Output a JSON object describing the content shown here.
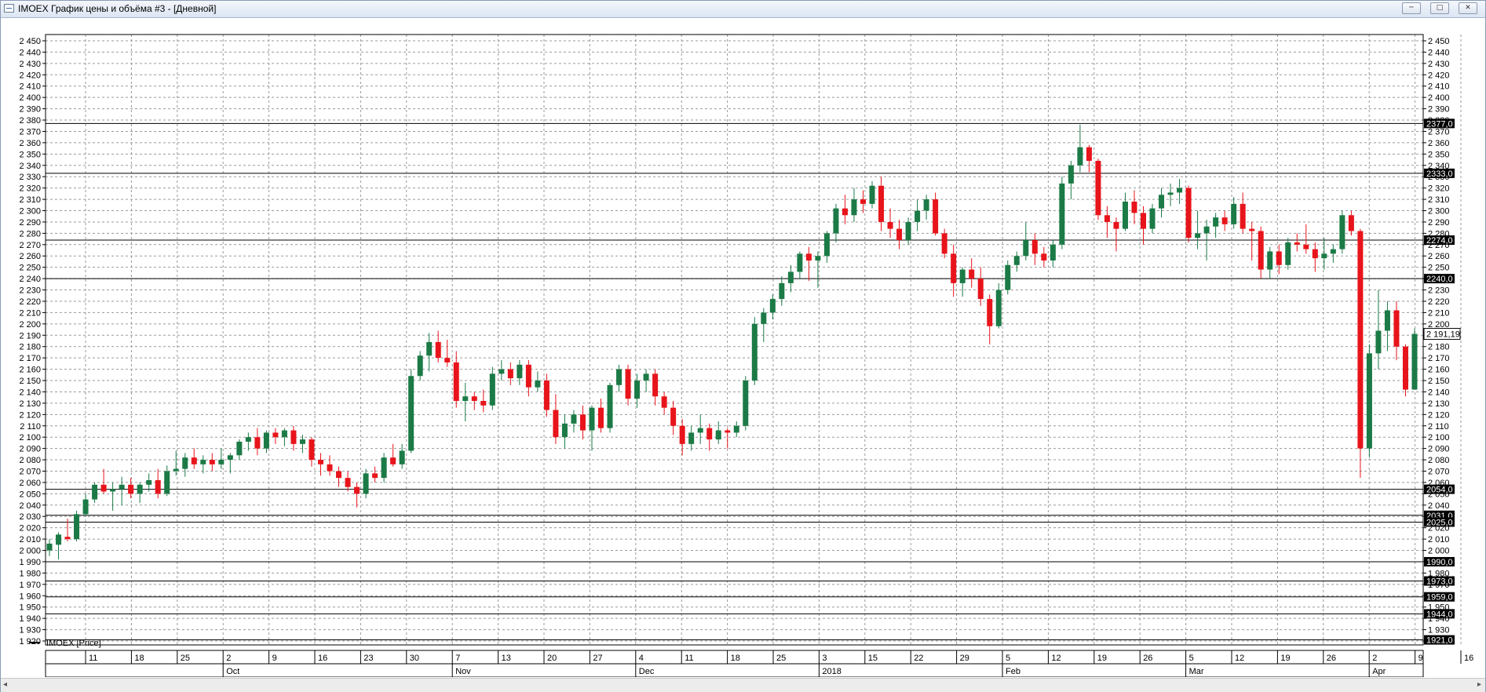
{
  "window": {
    "title": "IMOEX График цены и объёма #3 - [Дневной]",
    "buttons": [
      {
        "name": "minimize-button",
        "glyph": "─"
      },
      {
        "name": "maximize-button",
        "glyph": "□"
      },
      {
        "name": "close-button",
        "glyph": "✕"
      }
    ]
  },
  "legend": {
    "label": "IMOEX [Price]"
  },
  "scrollbar": {
    "left_arrow": "◂",
    "right_arrow": "▸"
  },
  "colors": {
    "up": "#1b7a46",
    "down": "#e8141b",
    "grid": "#9a9a9a",
    "axis": "#000000"
  },
  "chart_data": {
    "type": "candlestick",
    "title": "",
    "ylim": [
      1915,
      2455
    ],
    "y_ticks": [
      1920,
      1930,
      1940,
      1950,
      1960,
      1970,
      1980,
      1990,
      2000,
      2010,
      2020,
      2030,
      2040,
      2050,
      2060,
      2070,
      2080,
      2090,
      2100,
      2110,
      2120,
      2130,
      2140,
      2150,
      2160,
      2170,
      2180,
      2190,
      2200,
      2210,
      2220,
      2230,
      2240,
      2250,
      2260,
      2270,
      2280,
      2290,
      2300,
      2310,
      2320,
      2330,
      2340,
      2350,
      2360,
      2370,
      2380,
      2390,
      2400,
      2410,
      2420,
      2430,
      2440,
      2450
    ],
    "last_price": "2 191,19",
    "levels": [
      {
        "value": 2377,
        "label": "2377,0"
      },
      {
        "value": 2333,
        "label": "2333,0"
      },
      {
        "value": 2274,
        "label": "2274,0"
      },
      {
        "value": 2240,
        "label": "2240,0"
      },
      {
        "value": 2054,
        "label": "2054,0"
      },
      {
        "value": 2031,
        "label": "2031,0"
      },
      {
        "value": 2025,
        "label": "2025,0"
      },
      {
        "value": 1990,
        "label": "1990,0"
      },
      {
        "value": 1973,
        "label": "1973,0"
      },
      {
        "value": 1959,
        "label": "1959,0"
      },
      {
        "value": 1944,
        "label": "1944,0"
      },
      {
        "value": 1921,
        "label": "1921,0"
      }
    ],
    "x_day_labels": [
      "11",
      "18",
      "25",
      "2",
      "9",
      "16",
      "23",
      "30",
      "7",
      "13",
      "20",
      "27",
      "4",
      "11",
      "18",
      "25",
      "3",
      "15",
      "22",
      "29",
      "5",
      "12",
      "19",
      "26",
      "5",
      "12",
      "19",
      "26",
      "2",
      "9",
      "16"
    ],
    "x_month_labels": [
      "Oct",
      "Nov",
      "Dec",
      "2018",
      "Feb",
      "Mar",
      "Apr"
    ],
    "candles": [
      [
        2000,
        2010,
        1995,
        2006
      ],
      [
        2005,
        2016,
        1992,
        2014
      ],
      [
        2012,
        2028,
        2008,
        2010
      ],
      [
        2010,
        2035,
        2008,
        2032
      ],
      [
        2032,
        2050,
        2030,
        2045
      ],
      [
        2045,
        2060,
        2042,
        2058
      ],
      [
        2058,
        2072,
        2050,
        2052
      ],
      [
        2052,
        2060,
        2035,
        2054
      ],
      [
        2054,
        2065,
        2040,
        2058
      ],
      [
        2058,
        2064,
        2046,
        2050
      ],
      [
        2050,
        2060,
        2042,
        2058
      ],
      [
        2058,
        2068,
        2052,
        2062
      ],
      [
        2062,
        2072,
        2046,
        2050
      ],
      [
        2050,
        2075,
        2048,
        2070
      ],
      [
        2070,
        2088,
        2066,
        2072
      ],
      [
        2072,
        2086,
        2065,
        2082
      ],
      [
        2082,
        2090,
        2072,
        2076
      ],
      [
        2076,
        2084,
        2068,
        2080
      ],
      [
        2080,
        2086,
        2070,
        2076
      ],
      [
        2076,
        2090,
        2072,
        2080
      ],
      [
        2080,
        2086,
        2068,
        2084
      ],
      [
        2084,
        2098,
        2080,
        2096
      ],
      [
        2096,
        2104,
        2088,
        2100
      ],
      [
        2100,
        2108,
        2084,
        2090
      ],
      [
        2090,
        2106,
        2086,
        2104
      ],
      [
        2104,
        2108,
        2094,
        2100
      ],
      [
        2100,
        2108,
        2092,
        2106
      ],
      [
        2106,
        2110,
        2088,
        2094
      ],
      [
        2094,
        2102,
        2086,
        2098
      ],
      [
        2098,
        2100,
        2074,
        2080
      ],
      [
        2080,
        2086,
        2066,
        2076
      ],
      [
        2076,
        2084,
        2066,
        2070
      ],
      [
        2070,
        2074,
        2056,
        2064
      ],
      [
        2064,
        2070,
        2052,
        2056
      ],
      [
        2056,
        2060,
        2038,
        2050
      ],
      [
        2050,
        2072,
        2046,
        2068
      ],
      [
        2068,
        2074,
        2060,
        2064
      ],
      [
        2064,
        2086,
        2060,
        2082
      ],
      [
        2082,
        2094,
        2074,
        2076
      ],
      [
        2076,
        2094,
        2072,
        2088
      ],
      [
        2088,
        2160,
        2086,
        2154
      ],
      [
        2154,
        2176,
        2150,
        2172
      ],
      [
        2172,
        2192,
        2158,
        2184
      ],
      [
        2184,
        2194,
        2166,
        2170
      ],
      [
        2170,
        2186,
        2162,
        2166
      ],
      [
        2166,
        2176,
        2126,
        2132
      ],
      [
        2132,
        2148,
        2114,
        2136
      ],
      [
        2136,
        2140,
        2124,
        2132
      ],
      [
        2132,
        2142,
        2122,
        2128
      ],
      [
        2128,
        2162,
        2124,
        2156
      ],
      [
        2156,
        2168,
        2150,
        2160
      ],
      [
        2160,
        2166,
        2146,
        2152
      ],
      [
        2152,
        2168,
        2146,
        2164
      ],
      [
        2164,
        2168,
        2136,
        2144
      ],
      [
        2144,
        2158,
        2140,
        2150
      ],
      [
        2150,
        2156,
        2118,
        2124
      ],
      [
        2124,
        2138,
        2094,
        2100
      ],
      [
        2100,
        2120,
        2090,
        2112
      ],
      [
        2112,
        2124,
        2104,
        2120
      ],
      [
        2120,
        2128,
        2098,
        2106
      ],
      [
        2106,
        2128,
        2088,
        2126
      ],
      [
        2126,
        2134,
        2104,
        2108
      ],
      [
        2108,
        2148,
        2104,
        2146
      ],
      [
        2146,
        2164,
        2140,
        2160
      ],
      [
        2160,
        2164,
        2128,
        2134
      ],
      [
        2134,
        2156,
        2126,
        2150
      ],
      [
        2150,
        2160,
        2140,
        2156
      ],
      [
        2156,
        2160,
        2128,
        2136
      ],
      [
        2136,
        2140,
        2120,
        2126
      ],
      [
        2126,
        2132,
        2102,
        2110
      ],
      [
        2110,
        2116,
        2084,
        2094
      ],
      [
        2094,
        2110,
        2088,
        2104
      ],
      [
        2104,
        2120,
        2094,
        2108
      ],
      [
        2108,
        2112,
        2088,
        2098
      ],
      [
        2098,
        2114,
        2094,
        2106
      ],
      [
        2106,
        2108,
        2090,
        2104
      ],
      [
        2104,
        2114,
        2100,
        2110
      ],
      [
        2110,
        2154,
        2106,
        2150
      ],
      [
        2150,
        2206,
        2146,
        2200
      ],
      [
        2200,
        2214,
        2184,
        2210
      ],
      [
        2210,
        2226,
        2204,
        2222
      ],
      [
        2222,
        2242,
        2216,
        2236
      ],
      [
        2236,
        2252,
        2228,
        2246
      ],
      [
        2246,
        2264,
        2240,
        2262
      ],
      [
        2262,
        2268,
        2238,
        2256
      ],
      [
        2256,
        2264,
        2232,
        2260
      ],
      [
        2260,
        2282,
        2254,
        2280
      ],
      [
        2280,
        2306,
        2272,
        2302
      ],
      [
        2302,
        2314,
        2288,
        2296
      ],
      [
        2296,
        2320,
        2290,
        2310
      ],
      [
        2310,
        2318,
        2298,
        2306
      ],
      [
        2306,
        2326,
        2302,
        2322
      ],
      [
        2322,
        2330,
        2282,
        2290
      ],
      [
        2290,
        2302,
        2276,
        2284
      ],
      [
        2284,
        2292,
        2266,
        2274
      ],
      [
        2274,
        2294,
        2270,
        2290
      ],
      [
        2290,
        2310,
        2282,
        2300
      ],
      [
        2300,
        2314,
        2292,
        2310
      ],
      [
        2310,
        2316,
        2278,
        2280
      ],
      [
        2280,
        2284,
        2258,
        2262
      ],
      [
        2262,
        2270,
        2224,
        2236
      ],
      [
        2236,
        2250,
        2224,
        2248
      ],
      [
        2248,
        2258,
        2232,
        2240
      ],
      [
        2240,
        2250,
        2216,
        2222
      ],
      [
        2222,
        2226,
        2182,
        2198
      ],
      [
        2198,
        2236,
        2196,
        2230
      ],
      [
        2230,
        2256,
        2226,
        2252
      ],
      [
        2252,
        2264,
        2246,
        2260
      ],
      [
        2260,
        2290,
        2256,
        2274
      ],
      [
        2274,
        2280,
        2252,
        2262
      ],
      [
        2262,
        2268,
        2250,
        2256
      ],
      [
        2256,
        2274,
        2250,
        2270
      ],
      [
        2270,
        2330,
        2266,
        2324
      ],
      [
        2324,
        2344,
        2310,
        2340
      ],
      [
        2340,
        2376,
        2334,
        2356
      ],
      [
        2356,
        2358,
        2334,
        2344
      ],
      [
        2344,
        2346,
        2292,
        2296
      ],
      [
        2296,
        2304,
        2276,
        2290
      ],
      [
        2290,
        2294,
        2264,
        2284
      ],
      [
        2284,
        2316,
        2282,
        2308
      ],
      [
        2308,
        2318,
        2288,
        2298
      ],
      [
        2298,
        2304,
        2270,
        2284
      ],
      [
        2284,
        2306,
        2280,
        2302
      ],
      [
        2302,
        2320,
        2294,
        2314
      ],
      [
        2314,
        2324,
        2304,
        2316
      ],
      [
        2316,
        2328,
        2306,
        2320
      ],
      [
        2320,
        2322,
        2272,
        2276
      ],
      [
        2276,
        2300,
        2266,
        2280
      ],
      [
        2280,
        2292,
        2256,
        2286
      ],
      [
        2286,
        2298,
        2276,
        2294
      ],
      [
        2294,
        2300,
        2282,
        2288
      ],
      [
        2288,
        2312,
        2284,
        2306
      ],
      [
        2306,
        2316,
        2280,
        2284
      ],
      [
        2284,
        2290,
        2256,
        2282
      ],
      [
        2282,
        2286,
        2240,
        2248
      ],
      [
        2248,
        2268,
        2240,
        2264
      ],
      [
        2264,
        2270,
        2244,
        2252
      ],
      [
        2252,
        2276,
        2248,
        2272
      ],
      [
        2272,
        2280,
        2264,
        2270
      ],
      [
        2270,
        2288,
        2262,
        2266
      ],
      [
        2266,
        2272,
        2246,
        2258
      ],
      [
        2258,
        2276,
        2248,
        2262
      ],
      [
        2262,
        2270,
        2254,
        2266
      ],
      [
        2266,
        2300,
        2262,
        2296
      ],
      [
        2296,
        2300,
        2278,
        2282
      ],
      [
        2282,
        2284,
        2064,
        2090
      ],
      [
        2090,
        2182,
        2082,
        2174
      ],
      [
        2174,
        2230,
        2160,
        2194
      ],
      [
        2194,
        2220,
        2176,
        2212
      ],
      [
        2212,
        2220,
        2168,
        2180
      ],
      [
        2180,
        2182,
        2136,
        2142
      ],
      [
        2142,
        2196,
        2166,
        2191.19
      ]
    ]
  }
}
